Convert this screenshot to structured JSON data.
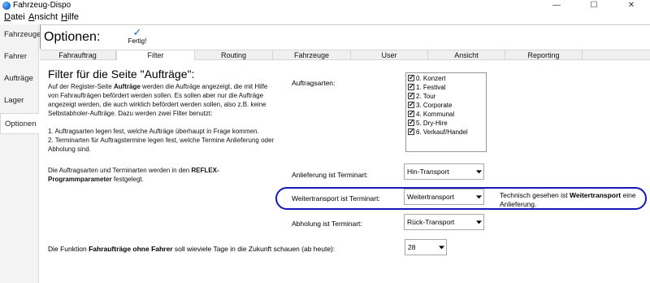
{
  "window": {
    "title": "Fahrzeug-Dispo",
    "minimize": "—",
    "maximize": "☐",
    "close": "✕"
  },
  "menu": [
    {
      "prefix": "",
      "underlined": "D",
      "rest": "atei"
    },
    {
      "prefix": "",
      "underlined": "A",
      "rest": "nsicht"
    },
    {
      "prefix": "",
      "underlined": "H",
      "rest": "ilfe"
    }
  ],
  "sidebar": {
    "items": [
      {
        "label": "Fahrzeuge"
      },
      {
        "label": "Fahrer"
      },
      {
        "label": "Aufträge"
      },
      {
        "label": "Lager"
      },
      {
        "label": "Optionen"
      }
    ]
  },
  "header": {
    "title": "Optionen:",
    "done_label": "Fertig!"
  },
  "tabs": [
    {
      "label": "Fahrauftrag"
    },
    {
      "label": "Filter"
    },
    {
      "label": "Routing"
    },
    {
      "label": "Fahrzeuge"
    },
    {
      "label": "User"
    },
    {
      "label": "Ansicht"
    },
    {
      "label": "Reporting"
    }
  ],
  "content": {
    "title": "Filter für die Seite \"Aufträge\":",
    "intro": {
      "a": "Auf der Register-Seite ",
      "b": "Aufträge",
      "c": " werden die Aufträge angezeigt, die mit Hilfe von Fahraufträgen befördert werden sollen. Es sollen aber nur die Aufträge angezeigt werden, die auch wirklich befördert werden sollen, also z.B. keine Selbstabholer-Aufträge. Dazu werden zwei Filter benutzt:"
    },
    "list_line1": "1. Auftragsarten legen fest, welche Aufträge überhaupt in Frage kommen.",
    "list_line2": "2. Terminarten für Auftragstermine legen fest, welche Termine Anlieferung oder Abholung sind.",
    "reflex": {
      "a": "Die Auftragsarten und Terminarten werden in den ",
      "b": "REFLEX-Programmparameter",
      "c": " festgelegt."
    },
    "auftragsarten_label": "Auftragsarten:",
    "auftragsarten": [
      "0. Konzert",
      "1. Festival",
      "2. Tour",
      "3. Corporate",
      "4. Kommunal",
      "5. Dry-Hire",
      "6. Verkauf/Handel"
    ],
    "anlieferung_label": "Anlieferung ist Terminart:",
    "anlieferung_value": "Hin-Transport",
    "weitertransport_label": "Weitertransport ist Terminart:",
    "weitertransport_value": "Weitertransport",
    "note": {
      "a": "Technisch gesehen ist ",
      "b": "Weitertransport",
      "c": " eine Anlieferung."
    },
    "abholung_label": "Abholung ist Terminart:",
    "abholung_value": "Rück-Transport",
    "days": {
      "a": "Die Funktion ",
      "b": "Fahraufträge ohne Fahrer",
      "c": " soll wieviele Tage in die Zukunft schauen (ab heute):"
    },
    "days_value": "28"
  },
  "colors": {
    "accent": "#1e63c5",
    "highlight": "#1818b8"
  }
}
